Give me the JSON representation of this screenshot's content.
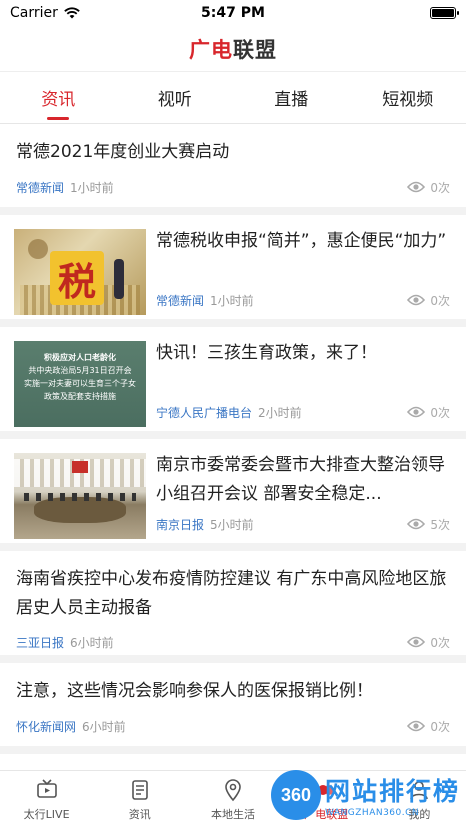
{
  "status_bar": {
    "carrier": "Carrier",
    "time": "5:47 PM"
  },
  "header": {
    "logo_part1": "广电",
    "logo_part2": "联盟"
  },
  "tabs": [
    {
      "label": "资讯",
      "active": true
    },
    {
      "label": "视听",
      "active": false
    },
    {
      "label": "直播",
      "active": false
    },
    {
      "label": "短视频",
      "active": false
    }
  ],
  "articles": [
    {
      "title": "常德2021年度创业大赛启动",
      "source": "常德新闻",
      "time": "1小时前",
      "views": "0次",
      "has_image": false
    },
    {
      "title": "常德税收申报“简并”，惠企便民“加力”",
      "source": "常德新闻",
      "time": "1小时前",
      "views": "0次",
      "has_image": true,
      "image_text": "税"
    },
    {
      "title": "快讯！三孩生育政策，来了！",
      "source": "宁德人民广播电台",
      "time": "2小时前",
      "views": "0次",
      "has_image": true,
      "image_lines": [
        "积极应对人口老龄化",
        "共中央政治局5月31日召开会",
        "实施一对夫妻可以生育三个子女",
        "政策及配套支持措施"
      ]
    },
    {
      "title": "南京市委常委会暨市大排查大整治领导小组召开会议 部署安全稳定...",
      "source": "南京日报",
      "time": "5小时前",
      "views": "5次",
      "has_image": true
    },
    {
      "title": "海南省疾控中心发布疫情防控建议 有广东中高风险地区旅居史人员主动报备",
      "source": "三亚日报",
      "time": "6小时前",
      "views": "0次",
      "has_image": false
    },
    {
      "title": "注意，这些情况会影响参保人的医保报销比例！",
      "source": "怀化新闻网",
      "time": "6小时前",
      "views": "0次",
      "has_image": false
    }
  ],
  "tabbar": [
    {
      "label": "太行LIVE",
      "icon": "tv-icon",
      "active": false
    },
    {
      "label": "资讯",
      "icon": "document-icon",
      "active": false
    },
    {
      "label": "本地生活",
      "icon": "location-pin-icon",
      "active": false
    },
    {
      "label": "广电联盟",
      "icon": "alliance-icon",
      "active": true
    },
    {
      "label": "我的",
      "icon": "person-icon",
      "active": false
    }
  ],
  "watermark": {
    "badge": "360",
    "main": "网站排行榜",
    "sub": "WANGZHAN360.CN"
  },
  "colors": {
    "accent": "#d8262c",
    "source": "#3a76c4",
    "watermark": "#2a8ee8"
  }
}
